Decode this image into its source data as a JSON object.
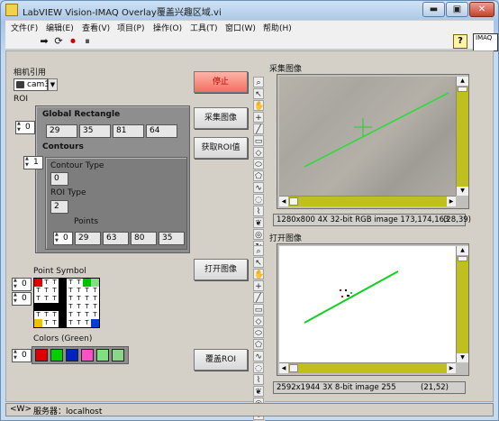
{
  "window": {
    "title": "LabVIEW Vision-IMAQ Overlay覆盖兴趣区域.vi",
    "minimize_label": "▬",
    "restore_label": "▣",
    "close_label": "✕"
  },
  "menu": [
    "文件(F)",
    "编辑(E)",
    "查看(V)",
    "项目(P)",
    "操作(O)",
    "工具(T)",
    "窗口(W)",
    "帮助(H)"
  ],
  "toolbar": {
    "run_icon": "run-arrow-icon",
    "run_continuous_icon": "run-continuous-icon",
    "abort_icon": "abort-icon",
    "pause_icon": "pause-icon",
    "help_label": "?",
    "vi_icon_text": "IMAQ"
  },
  "camera": {
    "label": "相机引用",
    "value": "cam3"
  },
  "roi": {
    "label": "ROI",
    "index": "0",
    "global_rect_label": "Global Rectangle",
    "global_rect": [
      "29",
      "35",
      "81",
      "64"
    ],
    "contours_label": "Contours",
    "contours_index": "1",
    "contour_type_label": "Contour Type",
    "contour_type": "0",
    "roi_type_label": "ROI Type",
    "roi_type": "2",
    "points_label": "Points",
    "points_index": "0",
    "points": [
      "29",
      "63",
      "80",
      "35"
    ]
  },
  "buttons": {
    "stop": "停止",
    "acquire": "采集图像",
    "get_roi": "获取ROI值",
    "open_image": "打开图像",
    "overlay_roi": "覆盖ROI"
  },
  "display1": {
    "label": "采集图像",
    "info": "1280x800 4X 32-bit RGB image 173,174,163",
    "coords": "(28,39)"
  },
  "display2": {
    "label": "打开图像",
    "info": "2592x1944 3X 8-bit image 255",
    "coords": "(21,52)"
  },
  "point_symbol": {
    "label": "Point Symbol",
    "index_top": "0",
    "index_bottom": "0",
    "glyph": "T"
  },
  "colors": {
    "label": "Colors (Green)",
    "index": "0",
    "swatches": [
      "#e00000",
      "#00d000",
      "#0020c0",
      "#ff50c8",
      "#80e080",
      "#88d888"
    ]
  },
  "status": {
    "left": "<W>",
    "server": "服务器：localhost"
  }
}
